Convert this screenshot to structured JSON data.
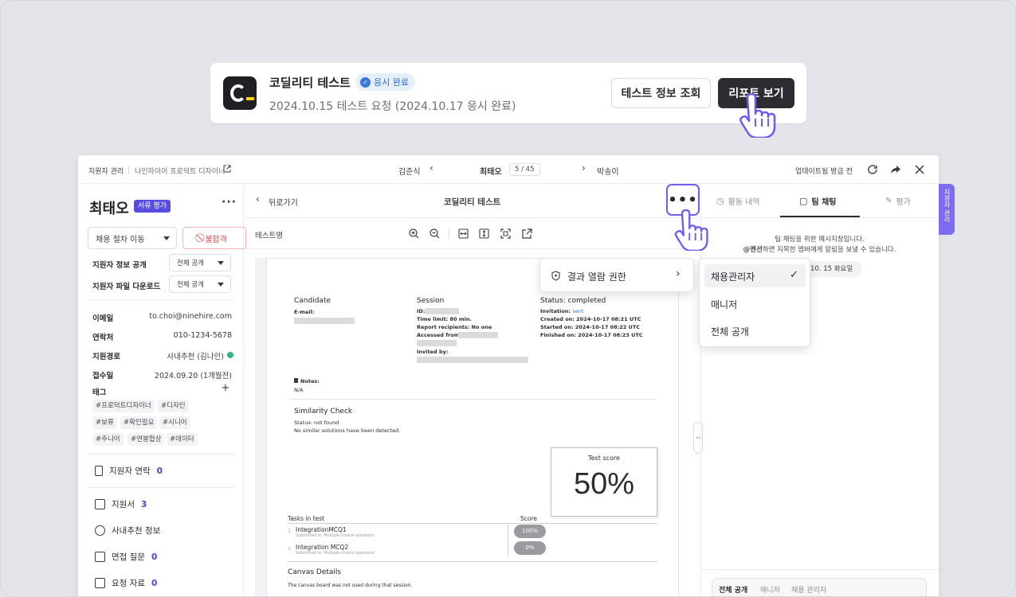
{
  "test_card": {
    "title": "코딜리티 테스트",
    "badge": "응시 완료",
    "subtitle": "2024.10.15 테스트 요청 (2024.10.17 응시 완료)",
    "btn_info": "테스트 정보 조회",
    "btn_report": "리포트 보기"
  },
  "topbar": {
    "breadcrumb_1": "지원자 관리",
    "breadcrumb_2": "나인하이어 프로덕트 디자이너",
    "prev_name": "김준식",
    "current_name": "최태오",
    "counter": "5 / 45",
    "next_name": "박송이",
    "updated": "업데이트됨 방금 전"
  },
  "candidate": {
    "name": "최태오",
    "stage": "서류 평가",
    "move_stage": "채용 절차 이동",
    "reject": "불합격",
    "info_public_label": "지원자 정보 공개",
    "info_public_value": "전체 공개",
    "file_download_label": "지원자 파일 다운로드",
    "file_download_value": "전체 공개",
    "email_label": "이메일",
    "email": "to.choi@ninehire.com",
    "phone_label": "연락처",
    "phone": "010-1234-5678",
    "source_label": "지원경로",
    "source": "사내추천 (김나인)",
    "applied_label": "접수일",
    "applied": "2024.09.20 (1개월전)",
    "tags_label": "태그",
    "tags": [
      "#프로덕트디자이너",
      "#디자인",
      "#보류",
      "#확인필요",
      "#시니어",
      "#주니어",
      "#연봉협상",
      "#데이터"
    ]
  },
  "side_menu": [
    {
      "label": "지원자 연락",
      "count": "0"
    },
    {
      "label": "지원서",
      "count": "3"
    },
    {
      "label": "사내추천 정보",
      "count": ""
    },
    {
      "label": "면접 질문",
      "count": "0"
    },
    {
      "label": "요청 자료",
      "count": "0"
    }
  ],
  "center": {
    "back": "뒤로가기",
    "title": "코딜리티 테스트",
    "test_name": "테스트명",
    "more": "•••"
  },
  "report": {
    "candidate": "Candidate",
    "email": "E-mail:",
    "session": "Session",
    "id": "ID:",
    "time_limit": "Time limit: 80 min.",
    "recipients": "Report recipients: No one",
    "accessed": "Accessed from:",
    "invited": "Invited by:",
    "status": "Status: completed",
    "invitation": "Invitation:",
    "invitation_value": "sent",
    "created": "Created on: 2024-10-17 08:21 UTC",
    "started": "Started on: 2024-10-17 08:22 UTC",
    "finished": "Finished on: 2024-10-17 08:23 UTC",
    "notes": "Notes:",
    "notes_value": "N/A",
    "similarity": "Similarity Check",
    "sim_status": "Status: not found",
    "sim_desc": "No similar solutions have been detected.",
    "score_label": "Test score",
    "score": "50%",
    "tasks": "Tasks in test",
    "score_col": "Score",
    "task1_no": "1",
    "task1": "IntegrationMCQ1",
    "task1_sub": "Submitted in: Multiple-choice questions",
    "task1_score": "100%",
    "task2_no": "2",
    "task2": "Integration MCQ2",
    "task2_sub": "Submitted in: Multiple-choice questions",
    "task2_score": "0%",
    "canvas": "Canvas Details",
    "canvas_desc": "The canvas board was not used during that session."
  },
  "right": {
    "tab_activity": "활동 내역",
    "tab_chat": "팀 채팅",
    "tab_eval": "평가",
    "chat_info1": "팀 채팅을 위한 메시지창입니다.",
    "chat_info2_bold": "@멘션",
    "chat_info2": "하면 지목한 멤버에게 알림을 보낼 수 있습니다.",
    "date_chip": "10. 15 화요일",
    "filter_all": "전체 공개",
    "filter_manager": "매니저",
    "filter_admin": "채용 관리자",
    "side_tab": "지원자 관리"
  },
  "menu": {
    "permission": "결과 열람 권한",
    "options": [
      "채용관리자",
      "매니저",
      "전체 공개"
    ]
  },
  "colors": {
    "accent": "#6f5cf0",
    "dark_button": "#2b2d33",
    "reject": "#e04848"
  }
}
